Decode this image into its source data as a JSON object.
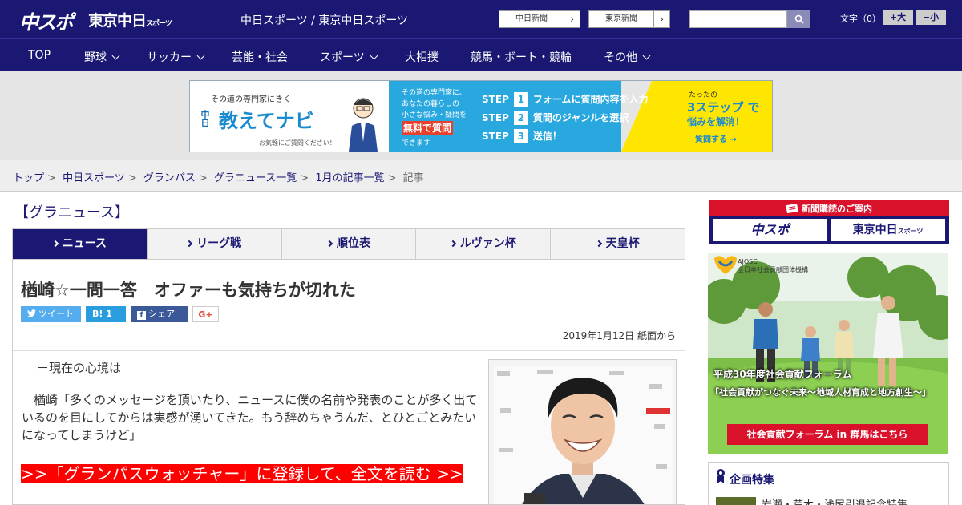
{
  "header": {
    "logo_main": "中スポ",
    "logo_tokyo": "東京中日",
    "logo_tokyo_small": "スポーツ",
    "site_title": "中日スポーツ / 東京中日スポーツ",
    "ext_links": [
      "中日新聞",
      "東京新聞"
    ],
    "fontsize_label": "文字（0）",
    "fontsize_up": "+大",
    "fontsize_down": "−小"
  },
  "nav": {
    "items": [
      "TOP",
      "野球",
      "サッカー",
      "芸能・社会",
      "スポーツ",
      "大相撲",
      "競馬・ボート・競輪",
      "その他"
    ]
  },
  "banner_ad": {
    "tagline": "その道の専門家にきく",
    "brand_prefix": "中日",
    "brand": "教えてナビ",
    "note": "お気軽にご質問ください！",
    "desc_lines": [
      "その道の専門家に、",
      "あなたの暮らしの",
      "小さな悩み・疑問を"
    ],
    "free": "無料で質問",
    "dekimasu": "できます",
    "steps": [
      {
        "label": "STEP",
        "num": "1",
        "text": "フォームに質問内容を入力"
      },
      {
        "label": "STEP",
        "num": "2",
        "text": "質問のジャンルを選択"
      },
      {
        "label": "STEP",
        "num": "3",
        "text": "送信！"
      }
    ],
    "y1": "たったの",
    "y2": "3ステップ で",
    "y3": "悩みを解消！",
    "cta": "質問する →"
  },
  "breadcrumb": [
    "トップ",
    "中日スポーツ",
    "グランパス",
    "グラニュース一覧",
    "1月の記事一覧",
    "記事"
  ],
  "category_title": "【グラニュース】",
  "tabs": [
    "ニュース",
    "リーグ戦",
    "順位表",
    "ルヴァン杯",
    "天皇杯"
  ],
  "article": {
    "headline": "楢崎☆一問一答　オファーも気持ちが切れた",
    "share": {
      "tweet": "ツイート",
      "hatena": "B! 1",
      "facebook": "シェア 0",
      "gplus": "G+"
    },
    "date": "2019年1月12日 紙面から",
    "question": "－現在の心境は",
    "answer": "楢崎「多くのメッセージを頂いたり、ニュースに僕の名前や発表のことが多く出ているのを目にしてからは実感が湧いてきた。もう辞めちゃうんだ、とひとごとみたいになってしまうけど」",
    "register_link": ">>「グランパスウォッチャー」に登録して、全文を読む >>"
  },
  "sidebar": {
    "sub_head": "新聞購読のご案内",
    "sub_left": "中スポ",
    "sub_right": "東京中日",
    "sub_right_small": "スポーツ",
    "forum_org_en": "AJOSC",
    "forum_org": "全日本社会貢献団体機構",
    "forum_title": "平成30年度社会貢献フォーラム",
    "forum_sub": "「社会貢献がつなぐ未来～地域人材育成と地方創生～」",
    "forum_btn": "社会貢献フォーラム in 群馬はこちら",
    "kikaku_head": "企画特集",
    "kikaku_item": "岩瀬・荒木・浅尾引退記念特集"
  },
  "colors": {
    "navy": "#1a1872",
    "red": "#d9112a",
    "link_red": "#ff0000",
    "blue": "#29a7df",
    "yellow": "#ffe600"
  }
}
